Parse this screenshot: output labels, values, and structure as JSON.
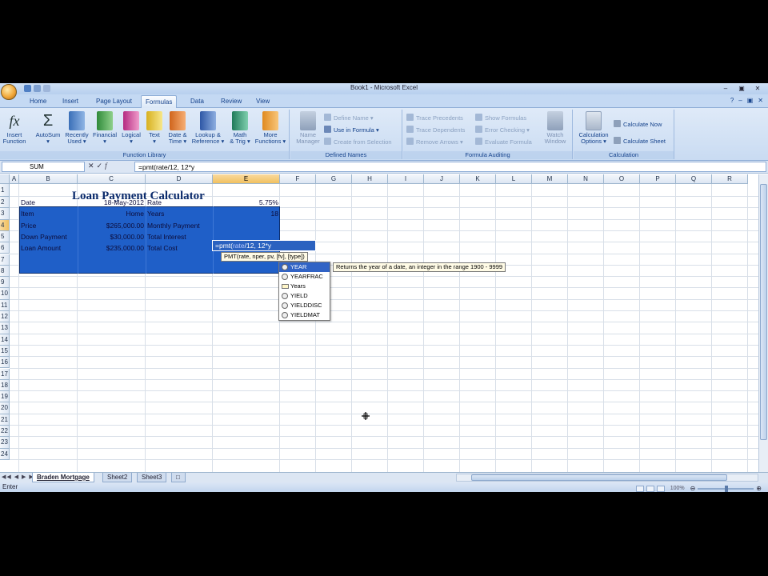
{
  "window": {
    "title": "Book1 - Microsoft Excel"
  },
  "ribbon": {
    "tabs": [
      "Home",
      "Insert",
      "Page Layout",
      "Formulas",
      "Data",
      "Review",
      "View"
    ],
    "active_tab": "Formulas",
    "function_library": {
      "label": "Function Library",
      "buttons": [
        {
          "line1": "Insert",
          "line2": "Function"
        },
        {
          "line1": "AutoSum",
          "line2": ""
        },
        {
          "line1": "Recently",
          "line2": "Used"
        },
        {
          "line1": "Financial",
          "line2": ""
        },
        {
          "line1": "Logical",
          "line2": ""
        },
        {
          "line1": "Text",
          "line2": ""
        },
        {
          "line1": "Date &",
          "line2": "Time"
        },
        {
          "line1": "Lookup &",
          "line2": "Reference"
        },
        {
          "line1": "Math",
          "line2": "& Trig"
        },
        {
          "line1": "More",
          "line2": "Functions"
        }
      ]
    },
    "defined_names": {
      "label": "Defined Names",
      "name_manager": {
        "line1": "Name",
        "line2": "Manager"
      },
      "define_name": "Define Name",
      "use_in_formula": "Use in Formula",
      "create_from_selection": "Create from Selection"
    },
    "formula_auditing": {
      "label": "Formula Auditing",
      "trace_precedents": "Trace Precedents",
      "trace_dependents": "Trace Dependents",
      "remove_arrows": "Remove Arrows",
      "show_formulas": "Show Formulas",
      "error_checking": "Error Checking",
      "evaluate_formula": "Evaluate Formula",
      "watch_window": {
        "line1": "Watch",
        "line2": "Window"
      }
    },
    "calculation": {
      "label": "Calculation",
      "options": {
        "line1": "Calculation",
        "line2": "Options"
      },
      "calculate_now": "Calculate Now",
      "calculate_sheet": "Calculate Sheet"
    }
  },
  "formula_bar": {
    "name_box": "SUM",
    "formula": "=pmt(rate/12, 12*y"
  },
  "grid": {
    "columns": [
      "A",
      "B",
      "C",
      "D",
      "E",
      "F",
      "G",
      "H",
      "I",
      "J",
      "K",
      "L",
      "M",
      "N",
      "O",
      "P",
      "Q",
      "R"
    ],
    "rows": [
      "1",
      "2",
      "3",
      "4",
      "5",
      "6",
      "7",
      "8",
      "9",
      "10",
      "11",
      "12",
      "13",
      "14",
      "15",
      "16",
      "17",
      "18",
      "19",
      "20",
      "21",
      "22",
      "23",
      "24"
    ],
    "active_column": "E",
    "active_row": "4"
  },
  "sheet": {
    "title": "Loan Payment Calculator",
    "left_labels": [
      "Date",
      "Item",
      "Price",
      "Down Payment",
      "Loan Amount"
    ],
    "left_values": [
      "18-May-2012",
      "Home",
      "$265,000.00",
      "$30,000.00",
      "$235,000.00"
    ],
    "right_labels": [
      "Rate",
      "Years",
      "Monthly Payment",
      "Total Interest",
      "Total Cost"
    ],
    "right_values": [
      "5.75%",
      "18",
      "",
      "",
      ""
    ],
    "edit_cell": {
      "prefix": "=pmt(",
      "ref": "rate",
      "suffix": "/12, 12*y"
    }
  },
  "tooltip": {
    "signature": "PMT(rate, nper, pv, [fv], [type])"
  },
  "autocomplete": {
    "items": [
      "YEAR",
      "YEARFRAC",
      "Years",
      "YIELD",
      "YIELDDISC",
      "YIELDMAT"
    ],
    "selected_index": 0,
    "description": "Returns the year of a date, an integer in the range 1900 - 9999"
  },
  "sheet_tabs": {
    "tabs": [
      "Braden Mortgage",
      "Sheet2",
      "Sheet3"
    ],
    "active": "Braden Mortgage"
  },
  "status_bar": {
    "mode": "Enter",
    "zoom": "100%"
  }
}
